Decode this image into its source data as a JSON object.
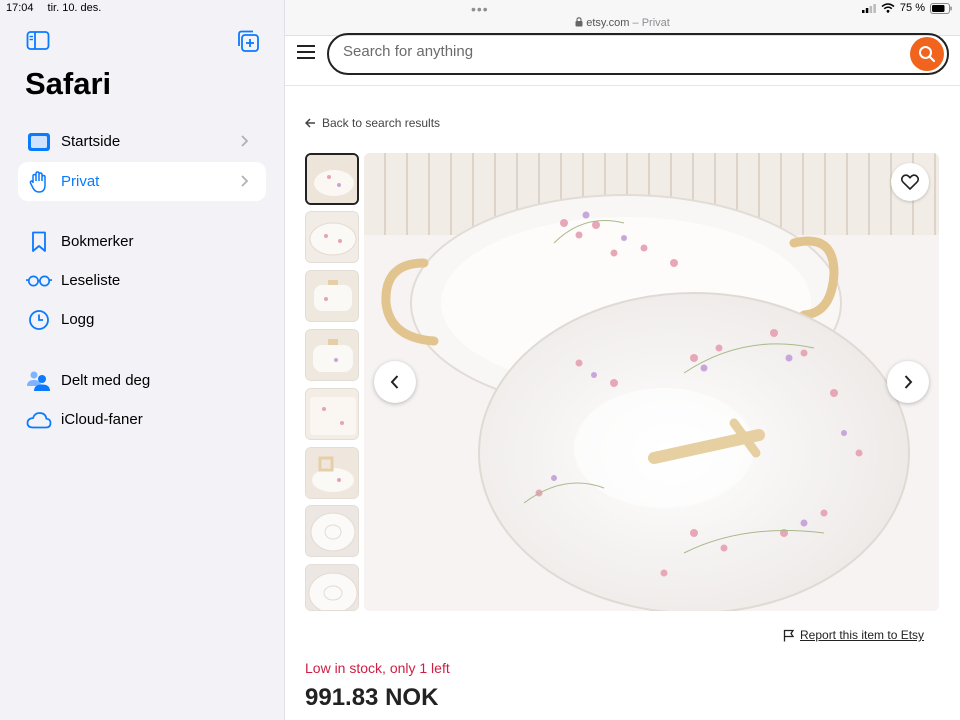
{
  "status": {
    "time": "17:04",
    "date": "tir. 10. des.",
    "battery": "75 %"
  },
  "sidebar": {
    "title": "Safari",
    "items": [
      {
        "label": "Startside",
        "icon": "start-page-icon",
        "chevron": true,
        "selected": false
      },
      {
        "label": "Privat",
        "icon": "private-hand-icon",
        "chevron": true,
        "selected": true
      },
      {
        "label": "Bokmerker",
        "icon": "bookmark-icon",
        "chevron": false,
        "selected": false
      },
      {
        "label": "Leseliste",
        "icon": "reading-list-glasses-icon",
        "chevron": false,
        "selected": false
      },
      {
        "label": "Logg",
        "icon": "history-clock-icon",
        "chevron": false,
        "selected": false
      },
      {
        "label": "Delt med deg",
        "icon": "shared-with-you-icon",
        "chevron": false,
        "selected": false
      },
      {
        "label": "iCloud-faner",
        "icon": "icloud-icon",
        "chevron": false,
        "selected": false
      }
    ]
  },
  "browser": {
    "url": "etsy.com",
    "mode": "Privat"
  },
  "search": {
    "placeholder": "Search for anything"
  },
  "listing": {
    "back_label": "Back to search results",
    "thumbnails_count": 8,
    "report_label": "Report this item to Etsy",
    "stock_label": "Low in stock, only 1 left",
    "price": "991.83 NOK"
  },
  "colors": {
    "accent": "#0a7aff",
    "etsy_orange": "#f1641e",
    "stock_red": "#d01e43",
    "sidebar_bg": "#f2f2f7"
  }
}
